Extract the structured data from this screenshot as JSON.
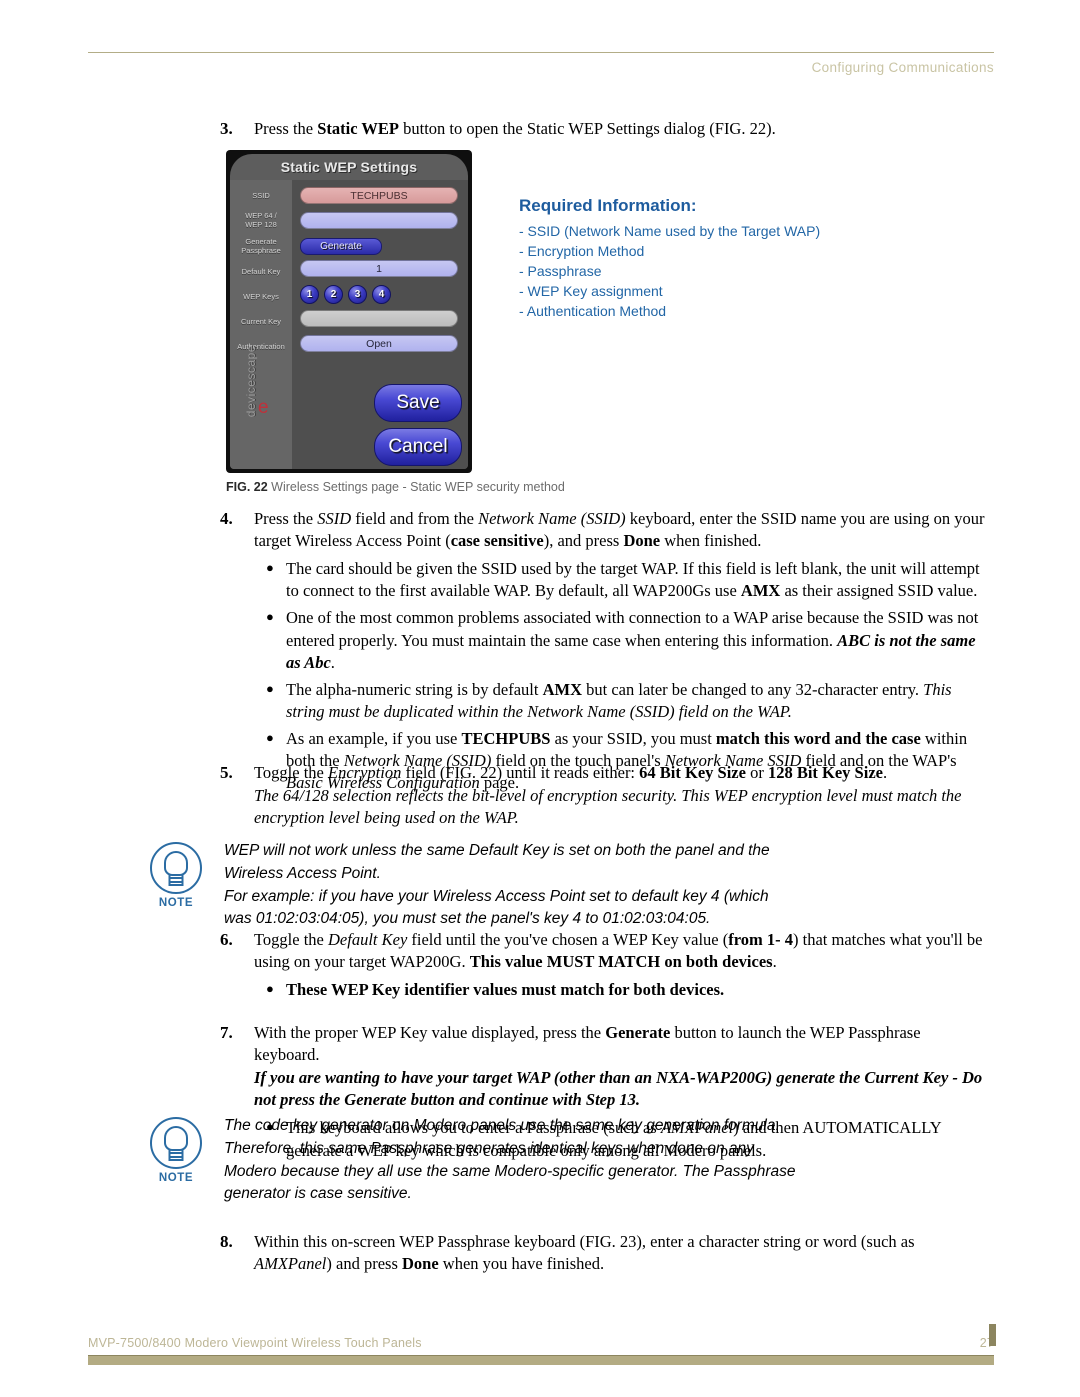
{
  "header": {
    "title": "Configuring Communications"
  },
  "footer": {
    "doc_title": "MVP-7500/8400 Modero Viewpoint Wireless Touch Panels",
    "page_number": "27"
  },
  "colors": {
    "header_rule": "#b3ad87",
    "header_text": "#c9c4a4",
    "footer_bar": "#b3ab83",
    "note_blue": "#2b6ca3",
    "reqinfo_blue": "#1e5c9e",
    "devicescape_red": "#c0303a"
  },
  "figure": {
    "caption_number": "FIG. 22",
    "caption_text": "Wireless Settings page - Static WEP security method",
    "dialog": {
      "title": "Static WEP Settings",
      "brand": "devicescape",
      "brand_mark": "e",
      "rows": [
        {
          "label": "SSID",
          "value": "TECHPUBS"
        },
        {
          "label": "WEP 64 /\nWEP 128",
          "value": ""
        },
        {
          "label": "Generate\nPassphrase",
          "value": "Generate"
        },
        {
          "label": "Default Key",
          "value": "1"
        },
        {
          "label": "WEP Keys",
          "value": "1 2 3 4"
        },
        {
          "label": "Current Key",
          "value": ""
        },
        {
          "label": "Authentication",
          "value": "Open"
        }
      ],
      "labels": {
        "ssid": "SSID",
        "wep_bits_line1": "WEP 64 /",
        "wep_bits_line2": "WEP 128",
        "generate_line1": "Generate",
        "generate_line2": "Passphrase",
        "default_key": "Default Key",
        "wep_keys": "WEP Keys",
        "current_key": "Current Key",
        "authentication": "Authentication"
      },
      "values": {
        "ssid": "TECHPUBS",
        "wep_bits": "",
        "generate_button": "Generate",
        "default_key": "1",
        "current_key": "",
        "authentication": "Open"
      },
      "wep_key_buttons": [
        "1",
        "2",
        "3",
        "4"
      ],
      "save_button": "Save",
      "cancel_button": "Cancel"
    }
  },
  "required_information": {
    "title": "Required Information:",
    "items": [
      "- SSID (Network Name used by the Target WAP)",
      "- Encryption Method",
      "- Passphrase",
      "- WEP Key assignment",
      "- Authentication Method"
    ]
  },
  "steps": {
    "step3": {
      "number": "3."
    },
    "step4": {
      "number": "4."
    },
    "step5": {
      "number": "5."
    },
    "step6": {
      "number": "6."
    },
    "step7": {
      "number": "7."
    },
    "step8": {
      "number": "8."
    }
  },
  "note1": {
    "icon_label": "NOTE",
    "line1": "WEP will not work unless the same Default Key is set on both the panel and the",
    "line2": "Wireless Access Point.",
    "line3": "For example: if you have your Wireless Access Point set to default key 4 (which",
    "line4": "was 01:02:03:04:05), you must set the panel's key 4 to 01:02:03:04:05."
  },
  "note2": {
    "icon_label": "NOTE",
    "line1": "The code key generator on Modero panels use the same key generation formula.",
    "line2": "Therefore, this same Passphrase generates identical keys when done on any",
    "line3": "Modero because they all use the same Modero-specific generator. The Passphrase",
    "line4": "generator is case sensitive."
  },
  "text": {
    "s3_a": "Press the ",
    "s3_b": "Static WEP",
    "s3_c": " button to open the Static WEP Settings dialog (FIG. 22).",
    "s4_a": "Press the ",
    "s4_b": "SSID",
    "s4_c": " field and from the ",
    "s4_d": "Network Name (SSID)",
    "s4_e": " keyboard, enter the SSID name you are using on your target Wireless Access Point (",
    "s4_f": "case sensitive",
    "s4_g": "), and press ",
    "s4_h": "Done",
    "s4_i": " when finished.",
    "s4b1_a": "The card should be given the SSID used by the target WAP. If this field is left blank, the unit will attempt to connect to the first available WAP. By default, all WAP200Gs use ",
    "s4b1_b": "AMX",
    "s4b1_c": " as their assigned SSID value.",
    "s4b2_a": "One of the most common problems associated with connection to a WAP arise because the SSID was not entered properly. You must maintain the same case when entering this information. ",
    "s4b2_b": "ABC is not the same as Abc",
    "s4b2_c": ".",
    "s4b3_a": "The alpha-numeric string is by default ",
    "s4b3_b": "AMX",
    "s4b3_c": " but can later be changed to any 32-character entry. ",
    "s4b3_d": "This string must be duplicated within the Network Name (SSID) field on the WAP.",
    "s4b4_a": "As an example, if you use ",
    "s4b4_b": "TECHPUBS",
    "s4b4_c": " as your SSID, you must ",
    "s4b4_d": "match this word and the case",
    "s4b4_e": " within both the ",
    "s4b4_f": "Network Name (SSID)",
    "s4b4_g": " field on the touch panel's ",
    "s4b4_h": "Network Name SSID",
    "s4b4_i": " field and on the WAP's ",
    "s4b4_j": "Basic Wireless Configuration",
    "s4b4_k": " page.",
    "s5_a": "Toggle the ",
    "s5_b": "Encryption",
    "s5_c": " field (FIG. 22) until it reads either: ",
    "s5_d": "64 Bit Key Size",
    "s5_e": " or ",
    "s5_f": "128 Bit Key Size",
    "s5_g": ".",
    "s5_italic": "The 64/128 selection reflects the bit-level of encryption security. This WEP encryption level must match the encryption level being used on the WAP.",
    "s6_a": "Toggle the ",
    "s6_b": "Default Key",
    "s6_c": " field until the you've chosen a WEP Key value (",
    "s6_d": "from 1- 4",
    "s6_e": ") that matches what you'll be using on your target WAP200G. ",
    "s6_f": "This value MUST MATCH on both devices",
    "s6_g": ".",
    "s6_bullet": "These WEP Key identifier values must match for both devices.",
    "s7_a": "With the proper WEP Key value displayed, press the ",
    "s7_b": "Generate",
    "s7_c": " button to launch the WEP Passphrase keyboard.",
    "s7_italic": "If you are wanting to have your target WAP (other than an NXA-WAP200G) generate the Current Key - Do not press the Generate button and continue with Step 13.",
    "s7_bullet_a": "This keyboard allows you to enter a Passphrase (such as ",
    "s7_bullet_b": "AMXPanel",
    "s7_bullet_c": ") and then AUTOMATICALLY generate a WEP key which is compatible only among all Modero panels.",
    "s8_a": "Within this on-screen WEP Passphrase keyboard (FIG. 23), enter a character string or word (such as ",
    "s8_b": "AMXPanel",
    "s8_c": ") and press ",
    "s8_d": "Done",
    "s8_e": " when you have finished."
  }
}
